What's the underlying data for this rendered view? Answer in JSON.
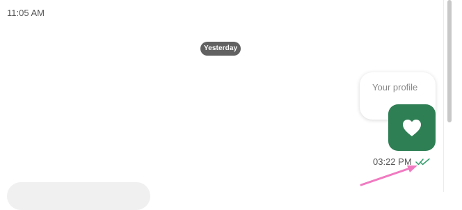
{
  "chat": {
    "top_time": "11:05 AM",
    "date_separator": "Yesterday",
    "profile_label": "Your profile",
    "sent_time": "03:22 PM",
    "status": "read"
  },
  "icons": {
    "heart": "heart-icon",
    "read_receipt": "double-check-icon",
    "annotation": "arrow-icon"
  },
  "colors": {
    "date_pill": "#616161",
    "heart_tile": "#2f7f55",
    "read_receipt": "#2f9d6a",
    "annotation_arrow": "#f07ac0"
  }
}
